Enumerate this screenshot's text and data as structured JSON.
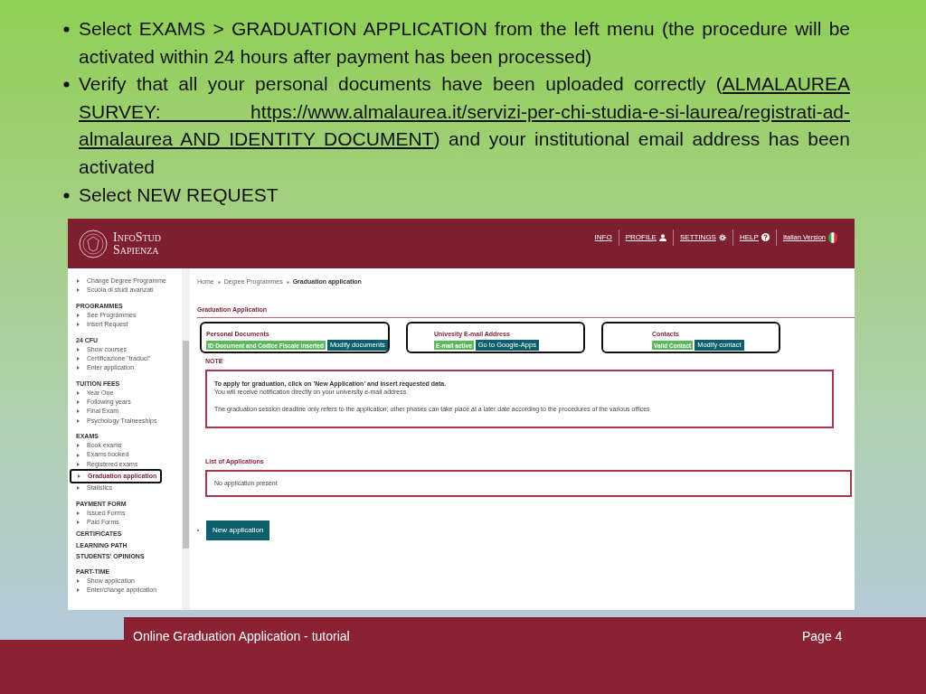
{
  "bullets": [
    {
      "parts": [
        {
          "text": "Select EXAMS > GRADUATION APPLICATION from the left menu (the procedure will be activated within 24 hours after payment has been processed)",
          "underline": false
        }
      ]
    },
    {
      "parts": [
        {
          "text": "Verify that all your personal documents have been uploaded correctly (",
          "underline": false
        },
        {
          "text": "ALMALAUREA SURVEY: https://www.almalaurea.it/servizi-per-chi-studia-e-si-laurea/registrati-ad-almalaurea AND IDENTITY DOCUMENT",
          "underline": true
        },
        {
          "text": ") and your institutional email address has been activated",
          "underline": false
        }
      ]
    },
    {
      "parts": [
        {
          "text": "Select NEW REQUEST",
          "underline": false
        }
      ]
    }
  ],
  "screenshot": {
    "logo": {
      "line1": "InfoStud",
      "line2": "Sapienza"
    },
    "nav": [
      {
        "label": "INFO"
      },
      {
        "label": "PROFILE"
      },
      {
        "label": "SETTINGS"
      },
      {
        "label": "HELP"
      },
      {
        "label": "Italian Version"
      }
    ],
    "sidebar": [
      {
        "items": [
          {
            "label": "Change Degree Programme",
            "selected": false
          },
          {
            "label": "Scuola di studi avanzati",
            "selected": false
          }
        ]
      },
      {
        "title": "PROGRAMMES",
        "items": [
          {
            "label": "See Programmes",
            "selected": false
          },
          {
            "label": "Insert Request",
            "selected": false
          }
        ]
      },
      {
        "title": "24 CFU",
        "items": [
          {
            "label": "Show courses",
            "selected": false
          },
          {
            "label": "Certificazione \"traduci\"",
            "selected": false
          },
          {
            "label": "Enter application",
            "selected": false
          }
        ]
      },
      {
        "title": "TUITION FEES",
        "items": [
          {
            "label": "Year One",
            "selected": false
          },
          {
            "label": "Following years",
            "selected": false
          },
          {
            "label": "Final Exam",
            "selected": false
          },
          {
            "label": "Psychology Traineeships",
            "selected": false
          }
        ]
      },
      {
        "title": "EXAMS",
        "items": [
          {
            "label": "Book exams",
            "selected": false
          },
          {
            "label": "Exams booked",
            "selected": false
          },
          {
            "label": "Registered exams",
            "selected": false
          },
          {
            "label": "Graduation application",
            "selected": true
          },
          {
            "label": "Statistics",
            "selected": false
          }
        ]
      },
      {
        "title": "PAYMENT FORM",
        "items": [
          {
            "label": "Issued Forms",
            "selected": false
          },
          {
            "label": "Paid Forms",
            "selected": false
          }
        ]
      },
      {
        "title": "CERTIFICATES"
      },
      {
        "title": "LEARNING PATH"
      },
      {
        "title": "STUDENTS' OPINIONS"
      },
      {
        "title": "PART-TIME",
        "items": [
          {
            "label": "Show application",
            "selected": false
          },
          {
            "label": "Enter/change application",
            "selected": false
          }
        ]
      }
    ],
    "breadcrumb": [
      "Home",
      "Degree Programmes",
      "Graduation application"
    ],
    "page_title": "Graduation Application",
    "cards": [
      {
        "title": "Personal Documents",
        "badge": "ID Document and Codice Fiscale inserted",
        "button": "Modify documents"
      },
      {
        "title": "Univesity E-mail Address",
        "badge": "E-mail active",
        "button": "Go to Google-Apps"
      },
      {
        "title": "Contacts",
        "badge": "Valid Contact",
        "button": "Modify contact"
      }
    ],
    "note": {
      "label": "NOTE",
      "lines": [
        "To apply for graduation, click on 'New Application' and insert requested data.",
        "You will receive notification directly on your university e-mail address.",
        "The graduation session deadline only refers to the application; other phases can take place at a later date according to the procedures of the various offices"
      ]
    },
    "list": {
      "title": "List of Applications",
      "empty": "No application present"
    },
    "new_button": "New application"
  },
  "footer": {
    "title": "Online Graduation Application - tutorial",
    "page": "Page 4"
  }
}
